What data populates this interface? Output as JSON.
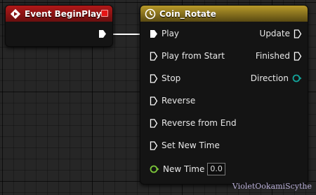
{
  "colors": {
    "event_header": "#8a1515",
    "timeline_header": "#8a7420",
    "exec_pin": "#ffffff",
    "float_pin": "#7cc63a",
    "enum_pin": "#13a39a",
    "canvas": "#262626"
  },
  "event_node": {
    "title": "Event BeginPlay",
    "icon": "event-diamond-icon"
  },
  "timeline_node": {
    "title": "Coin_Rotate",
    "icon": "timeline-clock-icon",
    "inputs": [
      {
        "label": "Play"
      },
      {
        "label": "Play from Start"
      },
      {
        "label": "Stop"
      },
      {
        "label": "Reverse"
      },
      {
        "label": "Reverse from End"
      },
      {
        "label": "Set New Time"
      }
    ],
    "new_time": {
      "label": "New Time",
      "value": "0.0"
    },
    "outputs": [
      {
        "label": "Update"
      },
      {
        "label": "Finished"
      },
      {
        "label": "Direction"
      }
    ]
  },
  "watermark": "VioletOokamiScythe"
}
